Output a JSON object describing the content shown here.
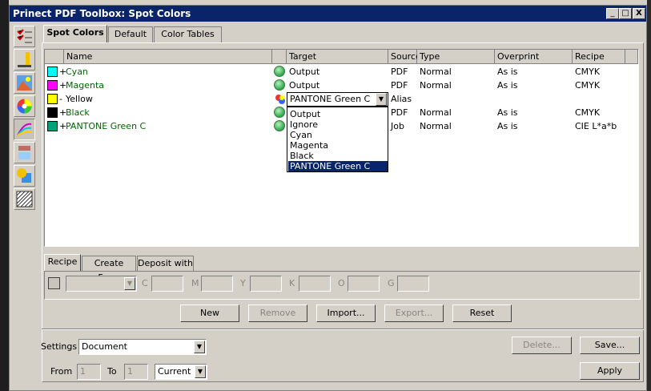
{
  "window": {
    "title": "Prinect PDF Toolbox: Spot Colors",
    "controls": [
      "_",
      "□",
      "X"
    ]
  },
  "tool_icons": [
    "checklist-icon",
    "color-bars-icon",
    "image-icon",
    "color-wheel-icon",
    "spot-color-icon",
    "ink-icon",
    "shapes-icon",
    "pattern-icon"
  ],
  "tabs": [
    "Spot Colors",
    "Default",
    "Color Tables"
  ],
  "table": {
    "headers": {
      "name": "Name",
      "target": "Target",
      "source": "Source",
      "type": "Type",
      "overprint": "Overprint",
      "recipe": "Recipe"
    },
    "rows": [
      {
        "prefix": "+",
        "name": "Cyan",
        "swatch": "#00ffff",
        "target": "Output",
        "source": "PDF",
        "type": "Normal",
        "overprint": "As is",
        "recipe": "CMYK"
      },
      {
        "prefix": "+",
        "name": "Magenta",
        "swatch": "#ff00ff",
        "target": "Output",
        "source": "PDF",
        "type": "Normal",
        "overprint": "As is",
        "recipe": "CMYK"
      },
      {
        "prefix": "-",
        "name": "Yellow",
        "swatch": "#ffff00",
        "target": "PANTONE Green C",
        "source": "Alias",
        "type": "",
        "overprint": "",
        "recipe": ""
      },
      {
        "prefix": "+",
        "name": "Black",
        "swatch": "#000000",
        "target": "",
        "source": "PDF",
        "type": "Normal",
        "overprint": "As is",
        "recipe": "CMYK"
      },
      {
        "prefix": "+",
        "name": "PANTONE Green C",
        "swatch": "#00a27a",
        "target": "",
        "source": "Job",
        "type": "Normal",
        "overprint": "As is",
        "recipe": "CIE L*a*b"
      }
    ]
  },
  "target_dropdown": {
    "value": "PANTONE Green C",
    "options": [
      "Output",
      "Ignore",
      "Cyan",
      "Magenta",
      "Black",
      "PANTONE Green C"
    ],
    "selected_index": 5
  },
  "sub_tabs": [
    "Recipe",
    "Create From",
    "Deposit with"
  ],
  "recipe_fields": [
    "C",
    "M",
    "Y",
    "K",
    "O",
    "G"
  ],
  "buttons": {
    "new": "New",
    "remove": "Remove",
    "import": "Import...",
    "export": "Export...",
    "reset": "Reset",
    "delete": "Delete...",
    "save": "Save...",
    "apply": "Apply"
  },
  "settings": {
    "label": "Settings",
    "value": "Document"
  },
  "range": {
    "from_label": "From",
    "from_value": "1",
    "to_label": "To",
    "to_value": "1",
    "page_value": "Current"
  },
  "colors": {
    "title_bar": "#0a246a",
    "selection": "#0a246a",
    "name_text": "#006400"
  }
}
